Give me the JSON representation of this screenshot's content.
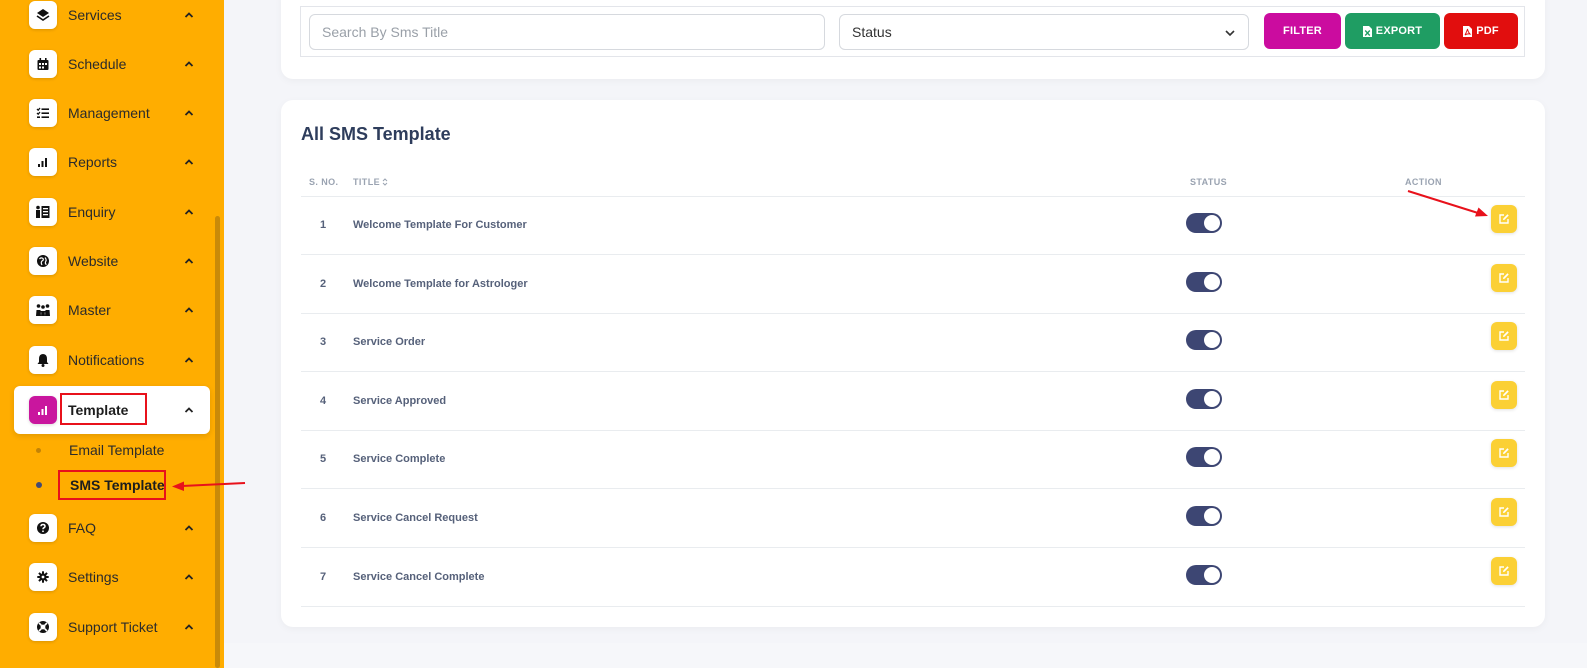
{
  "sidebar": {
    "items": [
      {
        "label": "Services",
        "icon": "services-icon"
      },
      {
        "label": "Schedule",
        "icon": "calendar-icon"
      },
      {
        "label": "Management",
        "icon": "checklist-icon"
      },
      {
        "label": "Reports",
        "icon": "bar-chart-icon"
      },
      {
        "label": "Enquiry",
        "icon": "enquiry-icon"
      },
      {
        "label": "Website",
        "icon": "globe-icon"
      },
      {
        "label": "Master",
        "icon": "users-icon"
      },
      {
        "label": "Notifications",
        "icon": "bell-icon"
      },
      {
        "label": "Template",
        "icon": "bar-chart-icon"
      },
      {
        "label": "FAQ",
        "icon": "question-icon"
      },
      {
        "label": "Settings",
        "icon": "gear-icon"
      },
      {
        "label": "Support Ticket",
        "icon": "lifebuoy-icon"
      }
    ],
    "sub_items": [
      {
        "label": "Email Template"
      },
      {
        "label": "SMS Template"
      }
    ],
    "active_item": "Template",
    "active_sub_item": "SMS Template"
  },
  "filters": {
    "search_placeholder": "Search By Sms Title",
    "status_selected": "Status",
    "filter_label": "FILTER",
    "export_label": "EXPORT",
    "pdf_label": "PDF"
  },
  "table": {
    "title": "All SMS Template",
    "columns": {
      "sno": "S. NO.",
      "title": "TITLE",
      "status": "STATUS",
      "action": "ACTION"
    },
    "rows": [
      {
        "sno": "1",
        "title": "Welcome Template For Customer",
        "status_on": true
      },
      {
        "sno": "2",
        "title": "Welcome Template for Astrologer",
        "status_on": true
      },
      {
        "sno": "3",
        "title": "Service Order",
        "status_on": true
      },
      {
        "sno": "4",
        "title": "Service Approved",
        "status_on": true
      },
      {
        "sno": "5",
        "title": "Service Complete",
        "status_on": true
      },
      {
        "sno": "6",
        "title": "Service Cancel Request",
        "status_on": true
      },
      {
        "sno": "7",
        "title": "Service Cancel Complete",
        "status_on": true
      }
    ]
  },
  "colors": {
    "sidebar_bg": "#ffad00",
    "active_icon_bg": "#c9169e",
    "filter_btn": "#cb0c9f",
    "export_btn": "#1f9d63",
    "pdf_btn": "#e10e0e",
    "toggle_on": "#3d4673",
    "edit_btn": "#fbd035",
    "annotation": "#e8111b"
  }
}
